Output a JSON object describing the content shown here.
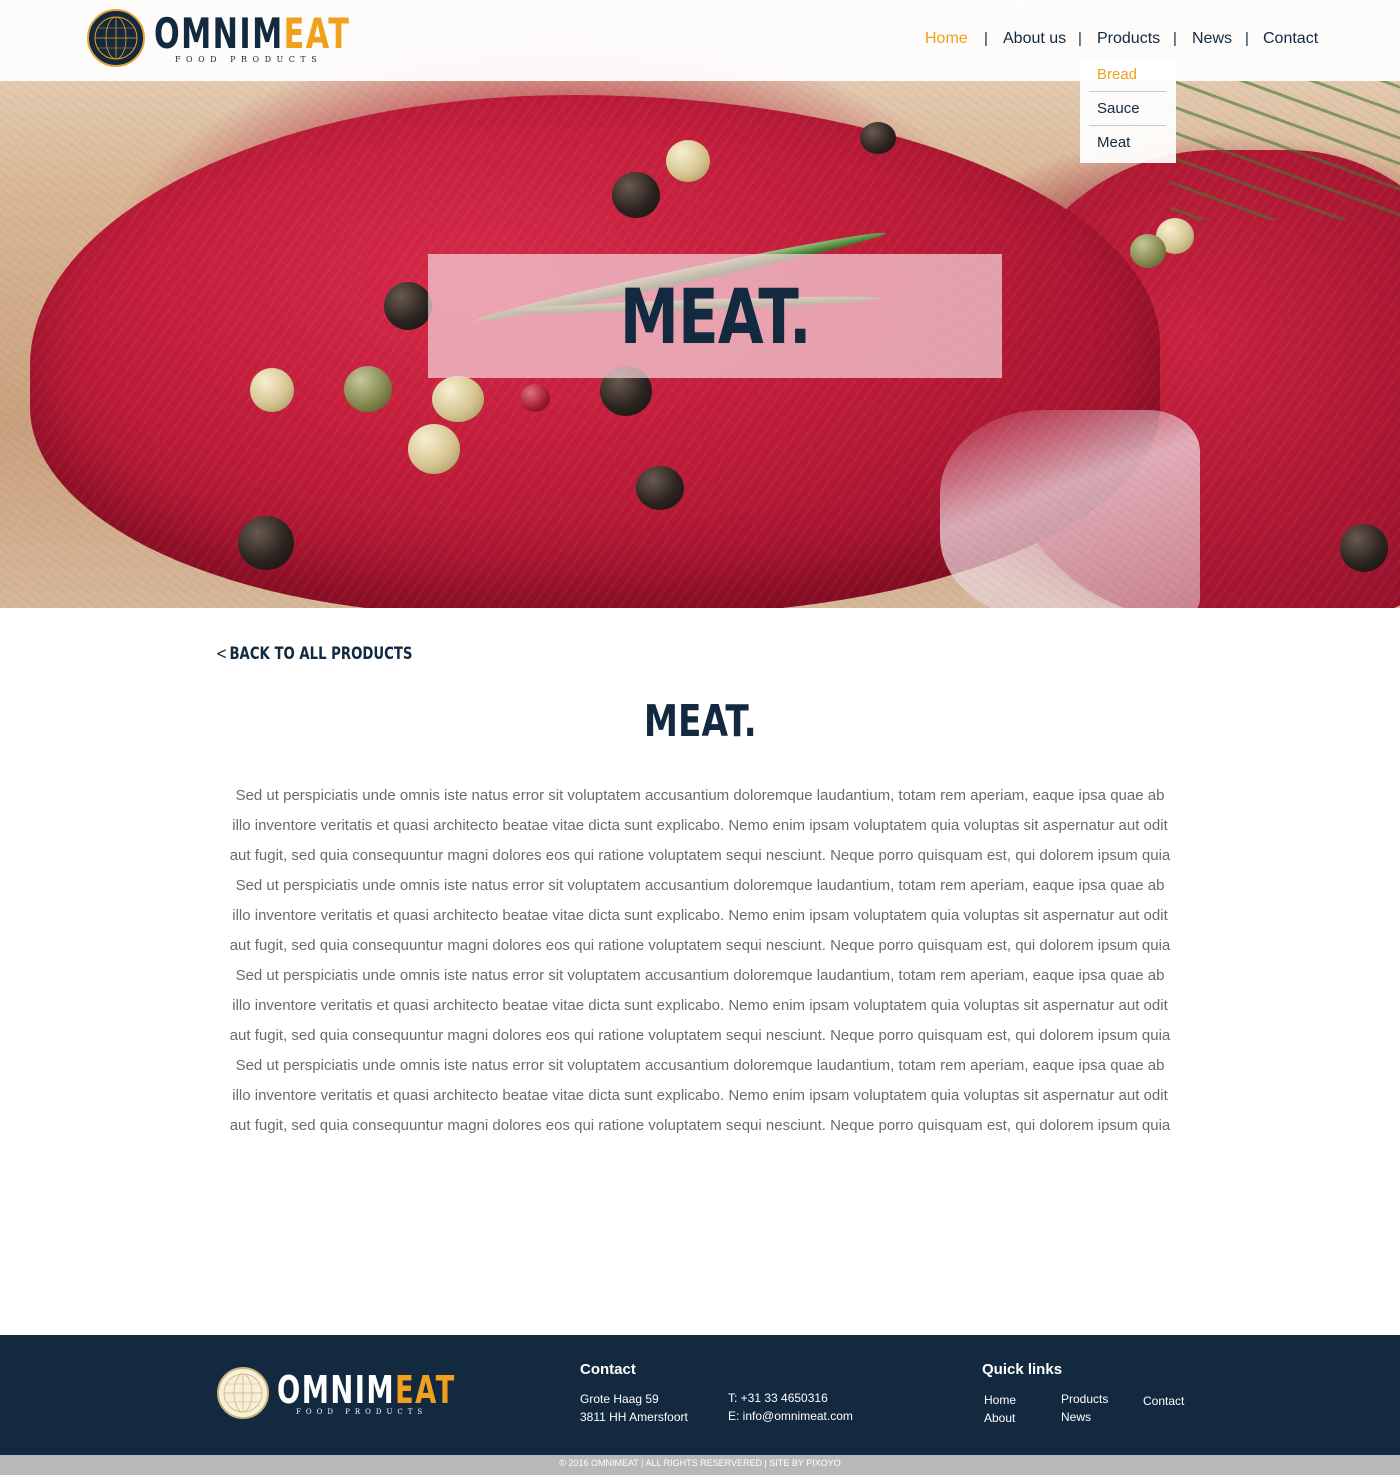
{
  "brand": {
    "name_part1": "OMNIM",
    "name_part2": "EAT",
    "tagline": "FOOD PRODUCTS"
  },
  "nav": {
    "items": [
      "Home",
      "About us",
      "Products",
      "News",
      "Contact"
    ],
    "active": "Home",
    "separator": "|",
    "products_dropdown": [
      "Bread",
      "Sauce",
      "Meat"
    ],
    "dropdown_active": "Bread"
  },
  "hero": {
    "title": "MEAT."
  },
  "content": {
    "back_link": "BACK TO ALL PRODUCTS",
    "back_chevron": "<",
    "title": "MEAT.",
    "paragraph_lines": [
      "Sed ut perspiciatis unde omnis iste natus error sit voluptatem accusantium doloremque laudantium, totam rem aperiam, eaque ipsa quae ab",
      "illo inventore veritatis et quasi architecto beatae vitae dicta sunt explicabo. Nemo enim ipsam voluptatem quia voluptas sit aspernatur aut odit",
      "aut fugit, sed quia consequuntur magni dolores eos qui ratione voluptatem sequi nesciunt. Neque porro quisquam est, qui dolorem ipsum quia",
      "Sed ut perspiciatis unde omnis iste natus error sit voluptatem accusantium doloremque laudantium, totam rem aperiam, eaque ipsa quae ab",
      "illo inventore veritatis et quasi architecto beatae vitae dicta sunt explicabo. Nemo enim ipsam voluptatem quia voluptas sit aspernatur aut odit",
      "aut fugit, sed quia consequuntur magni dolores eos qui ratione voluptatem sequi nesciunt. Neque porro quisquam est, qui dolorem ipsum quia",
      "Sed ut perspiciatis unde omnis iste natus error sit voluptatem accusantium doloremque laudantium, totam rem aperiam, eaque ipsa quae ab",
      "illo inventore veritatis et quasi architecto beatae vitae dicta sunt explicabo. Nemo enim ipsam voluptatem quia voluptas sit aspernatur aut odit",
      "aut fugit, sed quia consequuntur magni dolores eos qui ratione voluptatem sequi nesciunt. Neque porro quisquam est, qui dolorem ipsum quia",
      "Sed ut perspiciatis unde omnis iste natus error sit voluptatem accusantium doloremque laudantium, totam rem aperiam, eaque ipsa quae ab",
      "illo inventore veritatis et quasi architecto beatae vitae dicta sunt explicabo. Nemo enim ipsam voluptatem quia voluptas sit aspernatur aut odit",
      "aut fugit, sed quia consequuntur magni dolores eos qui ratione voluptatem sequi nesciunt. Neque porro quisquam est, qui dolorem ipsum quia"
    ]
  },
  "footer": {
    "contact_heading": "Contact",
    "address_line1": "Grote Haag 59",
    "address_line2": "3811 HH Amersfoort",
    "phone": "T: +31 33 4650316",
    "email": "E: info@omnimeat.com",
    "quicklinks_heading": "Quick links",
    "quicklinks": {
      "home": "Home",
      "about": "About",
      "products": "Products",
      "news": "News",
      "contact": "Contact"
    },
    "copyright": "© 2016 OMNIMEAT  |  ALL RIGHTS RESERVERED  |  SITE BY PIXOYO"
  },
  "colors": {
    "navy": "#12293f",
    "accent_orange": "#f0a01c",
    "body_text": "#6b6b6b",
    "footer_bg": "#12293f",
    "copyright_bg": "#b8b8b8"
  },
  "icons": [
    "globe-logo-icon"
  ]
}
